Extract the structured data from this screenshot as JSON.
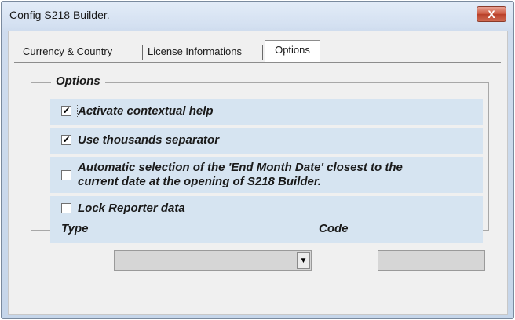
{
  "window": {
    "title": "Config S218 Builder.",
    "close_label": "X"
  },
  "tabs": [
    {
      "label": "Currency & Country"
    },
    {
      "label": "License Informations"
    },
    {
      "label": "Options"
    }
  ],
  "options": {
    "group_title": "Options",
    "items": [
      {
        "label": "Activate contextual help",
        "checked": true,
        "mark": "✔"
      },
      {
        "label": "Use thousands separator",
        "checked": true,
        "mark": "✔"
      },
      {
        "label_line1": "Automatic selection of the 'End Month Date' closest to the",
        "label_line2": "current date at the opening of S218 Builder.",
        "checked": false,
        "mark": ""
      },
      {
        "label": "Lock Reporter data",
        "checked": false,
        "mark": ""
      }
    ],
    "type_label": "Type",
    "type_value": "",
    "code_label": "Code",
    "code_value": ""
  },
  "colors": {
    "row_background": "#d6e4f1",
    "close_button": "#c9553c"
  }
}
